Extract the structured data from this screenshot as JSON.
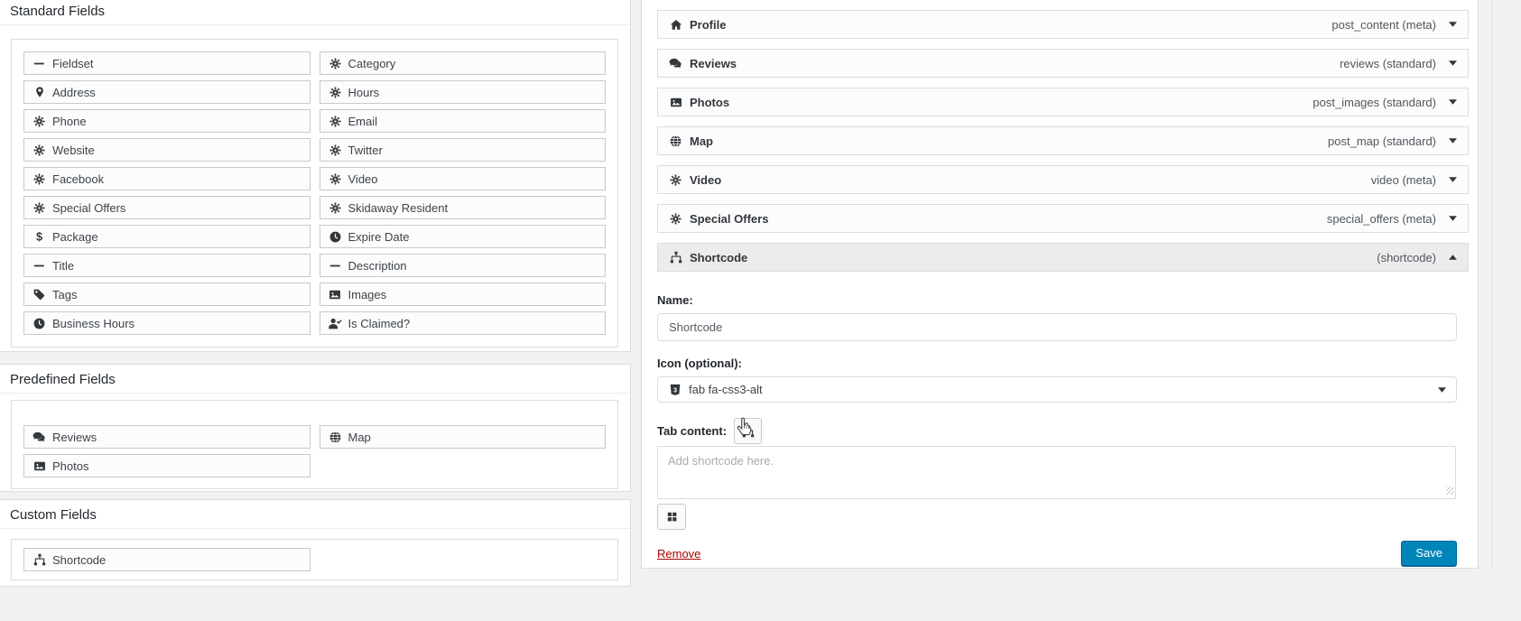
{
  "left": {
    "sections": [
      {
        "title": "Standard Fields",
        "fields": [
          {
            "label": "Fieldset",
            "icon": "minus"
          },
          {
            "label": "Category",
            "icon": "cog"
          },
          {
            "label": "Address",
            "icon": "map-marker"
          },
          {
            "label": "Hours",
            "icon": "cog"
          },
          {
            "label": "Phone",
            "icon": "cog"
          },
          {
            "label": "Email",
            "icon": "cog"
          },
          {
            "label": "Website",
            "icon": "cog"
          },
          {
            "label": "Twitter",
            "icon": "cog"
          },
          {
            "label": "Facebook",
            "icon": "cog"
          },
          {
            "label": "Video",
            "icon": "cog"
          },
          {
            "label": "Special Offers",
            "icon": "cog"
          },
          {
            "label": "Skidaway Resident",
            "icon": "cog"
          },
          {
            "label": "Package",
            "icon": "dollar"
          },
          {
            "label": "Expire Date",
            "icon": "clock"
          },
          {
            "label": "Title",
            "icon": "minus"
          },
          {
            "label": "Description",
            "icon": "minus"
          },
          {
            "label": "Tags",
            "icon": "tag"
          },
          {
            "label": "Images",
            "icon": "image"
          },
          {
            "label": "Business Hours",
            "icon": "clock"
          },
          {
            "label": "Is Claimed?",
            "icon": "user-check"
          }
        ]
      },
      {
        "title": "Predefined Fields",
        "fields": [
          {
            "label": "Reviews",
            "icon": "comments"
          },
          {
            "label": "Map",
            "icon": "globe"
          },
          {
            "label": "Photos",
            "icon": "image"
          }
        ]
      },
      {
        "title": "Custom Fields",
        "fields": [
          {
            "label": "Shortcode",
            "icon": "shortcode"
          }
        ]
      }
    ]
  },
  "right": {
    "rows": [
      {
        "title": "Profile",
        "icon": "home",
        "meta": "post_content (meta)"
      },
      {
        "title": "Reviews",
        "icon": "comments",
        "meta": "reviews (standard)"
      },
      {
        "title": "Photos",
        "icon": "image",
        "meta": "post_images (standard)"
      },
      {
        "title": "Map",
        "icon": "globe",
        "meta": "post_map (standard)"
      },
      {
        "title": "Video",
        "icon": "cog",
        "meta": "video (meta)"
      },
      {
        "title": "Special Offers",
        "icon": "cog",
        "meta": "special_offers (meta)"
      }
    ],
    "expanded": {
      "title": "Shortcode",
      "icon": "shortcode",
      "meta": "(shortcode)",
      "name_label": "Name:",
      "name_value": "Shortcode",
      "icon_label": "Icon (optional):",
      "icon_value": "fab fa-css3-alt",
      "icon_glyph": "css3",
      "tab_content_label": "Tab content:",
      "textarea_placeholder": "Add shortcode here.",
      "remove_label": "Remove",
      "save_label": "Save"
    },
    "colors": {
      "save_bg": "#0085ba",
      "save_border": "#006799",
      "remove_red": "#a00"
    }
  }
}
